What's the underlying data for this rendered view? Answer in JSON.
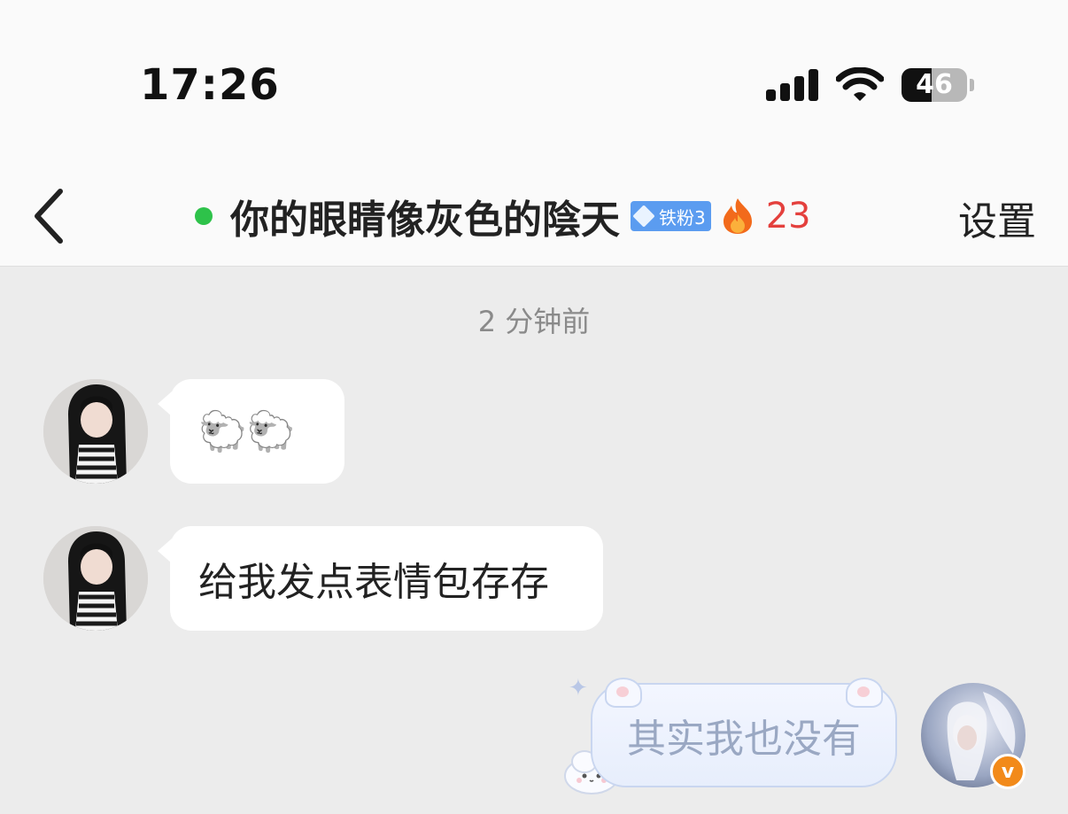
{
  "status_bar": {
    "time": "17:26",
    "battery": "46",
    "battery_level": 0.46
  },
  "header": {
    "title": "你的眼睛像灰色的陰天",
    "fan_badge": "铁粉3",
    "streak_count": "23",
    "settings_label": "设置",
    "online": true
  },
  "chat": {
    "timestamp": "2 分钟前",
    "messages": [
      {
        "side": "left",
        "text": "🐑🐑"
      },
      {
        "side": "left",
        "text": "给我发点表情包存存"
      },
      {
        "side": "right",
        "text": "其实我也没有"
      }
    ]
  },
  "colors": {
    "online": "#2ec24a",
    "streak": "#e4403d",
    "badge": "#5b9cf0",
    "vip": "#f28a1a"
  },
  "icons": [
    "back-chevron-icon",
    "fire-icon",
    "diamond-icon",
    "signal-icon",
    "wifi-icon",
    "battery-icon",
    "vip-v-icon"
  ]
}
